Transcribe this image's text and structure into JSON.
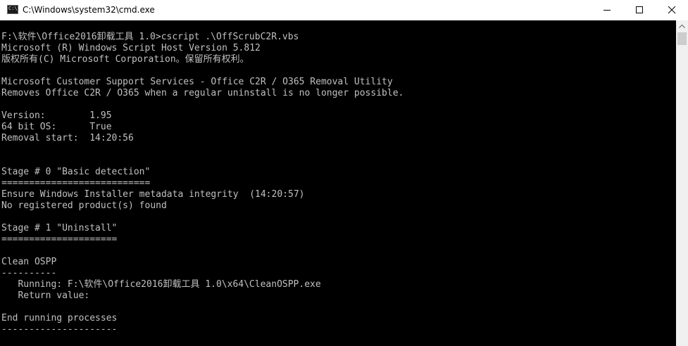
{
  "window": {
    "title": "C:\\Windows\\system32\\cmd.exe",
    "icon_glyph": "C:\\.",
    "icon": "cmd-icon",
    "controls": {
      "minimize": "minimize-icon",
      "maximize": "maximize-icon",
      "close": "close-icon"
    }
  },
  "console": {
    "foreground": "#c0c0c0",
    "background": "#000000",
    "lines": [
      "F:\\软件\\Office2016卸载工具 1.0>cscript .\\OffScrubC2R.vbs",
      "Microsoft (R) Windows Script Host Version 5.812",
      "版权所有(C) Microsoft Corporation。保留所有权利。",
      "",
      "Microsoft Customer Support Services - Office C2R / O365 Removal Utility",
      "Removes Office C2R / O365 when a regular uninstall is no longer possible.",
      "",
      "Version:        1.95",
      "64 bit OS:      True",
      "Removal start:  14:20:56",
      "",
      "",
      "Stage # 0 \"Basic detection\"",
      "===========================",
      "Ensure Windows Installer metadata integrity  (14:20:57)",
      "No registered product(s) found",
      "",
      "Stage # 1 \"Uninstall\"",
      "=====================",
      "",
      "Clean OSPP",
      "----------",
      "   Running: F:\\软件\\Office2016卸载工具 1.0\\x64\\CleanOSPP.exe",
      "   Return value:",
      "",
      "End running processes",
      "---------------------"
    ]
  },
  "scrollbar": {
    "up_icon": "scroll-up-arrow-icon"
  }
}
